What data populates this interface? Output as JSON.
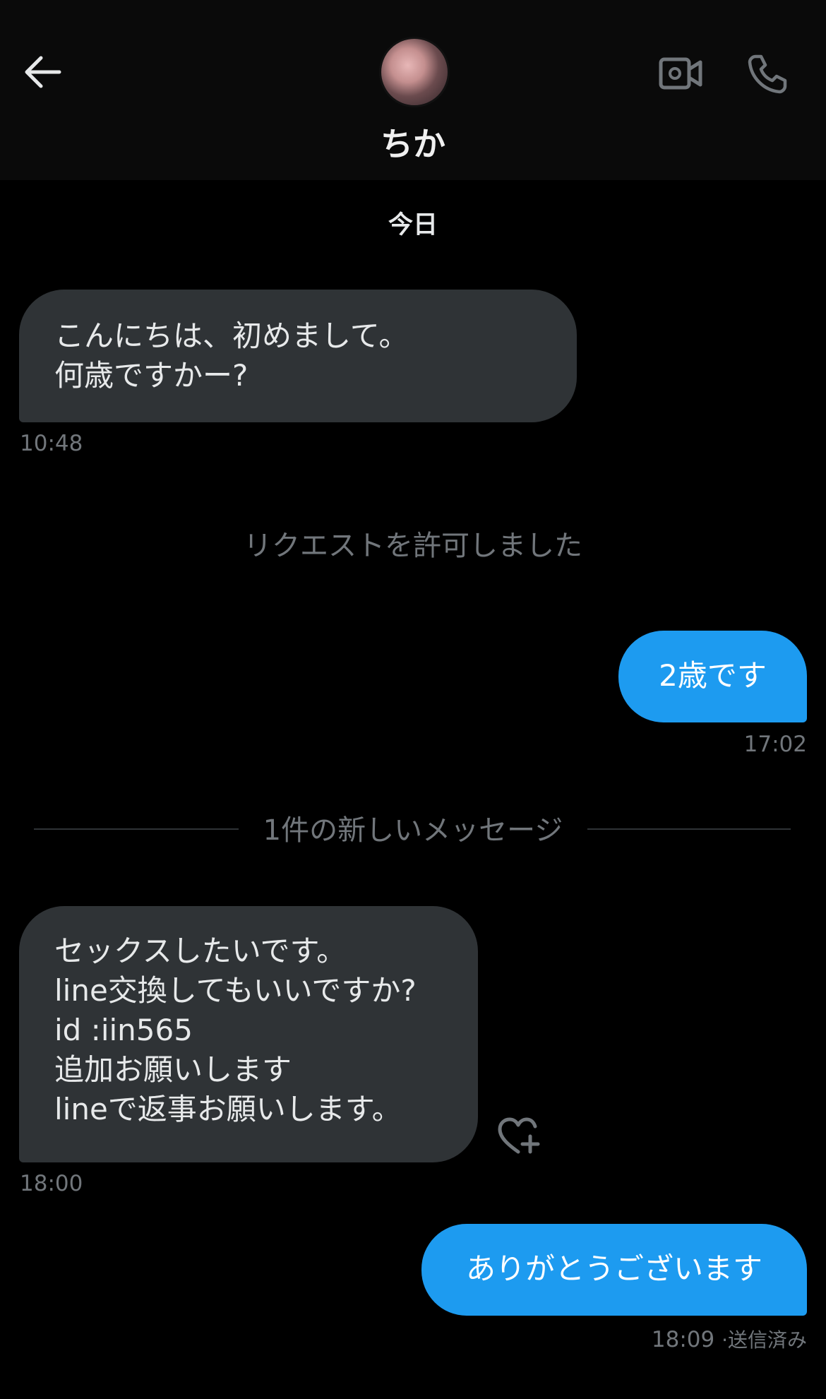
{
  "header": {
    "contact_name": "ちか",
    "back_icon": "arrow-left-icon",
    "video_icon": "video-camera-icon",
    "call_icon": "phone-icon"
  },
  "chat": {
    "day_label": "今日",
    "messages": [
      {
        "direction": "incoming",
        "text": "こんにちは、初めまして。\n何歳ですかー?",
        "time": "10:48"
      },
      {
        "direction": "outgoing",
        "text": "2歳です",
        "time": "17:02"
      },
      {
        "direction": "incoming",
        "text": "セックスしたいです。\nline交換してもいいですか?\nid :iin565\n追加お願いします\nlineで返事お願いします。",
        "time": "18:00"
      },
      {
        "direction": "outgoing",
        "text": "ありがとうございます",
        "time": "18:09",
        "status": "送信済み"
      }
    ],
    "system_note": "リクエストを許可しました",
    "new_messages_divider": "1件の新しいメッセージ"
  },
  "colors": {
    "background": "#000000",
    "incoming_bubble": "#2f3336",
    "outgoing_bubble": "#1d9bf0",
    "muted_text": "#71767b"
  }
}
